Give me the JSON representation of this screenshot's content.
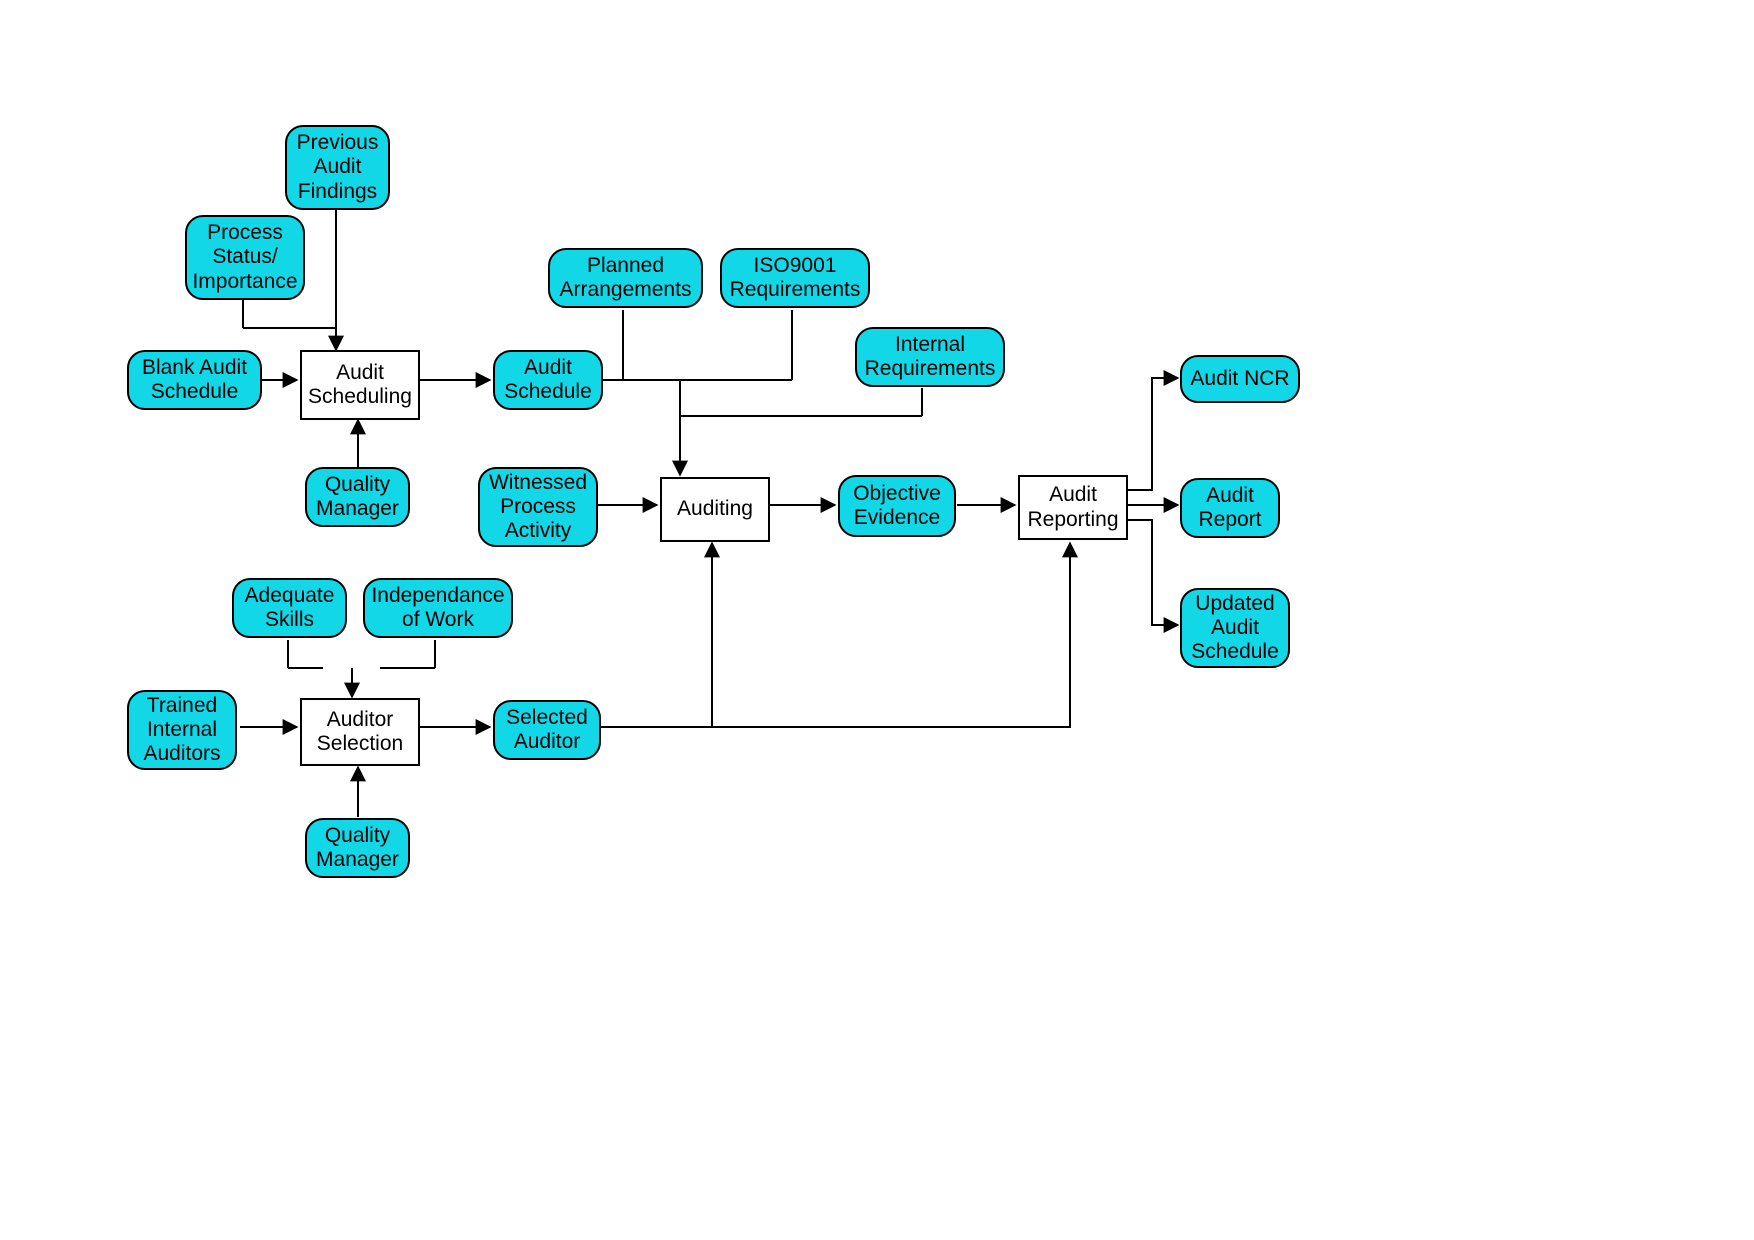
{
  "nodes": {
    "previous_audit_findings": "Previous\nAudit\nFindings",
    "process_status_importance": "Process\nStatus/\nImportance",
    "blank_audit_schedule": "Blank Audit\nSchedule",
    "audit_scheduling": "Audit\nScheduling",
    "audit_schedule": "Audit\nSchedule",
    "quality_manager_1": "Quality\nManager",
    "planned_arrangements": "Planned\nArrangements",
    "iso9001_requirements": "ISO9001\nRequirements",
    "internal_requirements": "Internal\nRequirements",
    "witnessed_process_activity": "Witnessed\nProcess\nActivity",
    "auditing": "Auditing",
    "objective_evidence": "Objective\nEvidence",
    "audit_reporting": "Audit\nReporting",
    "audit_ncr": "Audit NCR",
    "audit_report": "Audit\nReport",
    "updated_audit_schedule": "Updated\nAudit\nSchedule",
    "adequate_skills": "Adequate\nSkills",
    "independance_of_work": "Independance\nof Work",
    "trained_internal_auditors": "Trained\nInternal\nAuditors",
    "auditor_selection": "Auditor\nSelection",
    "selected_auditor": "Selected\nAuditor",
    "quality_manager_2": "Quality\nManager"
  }
}
